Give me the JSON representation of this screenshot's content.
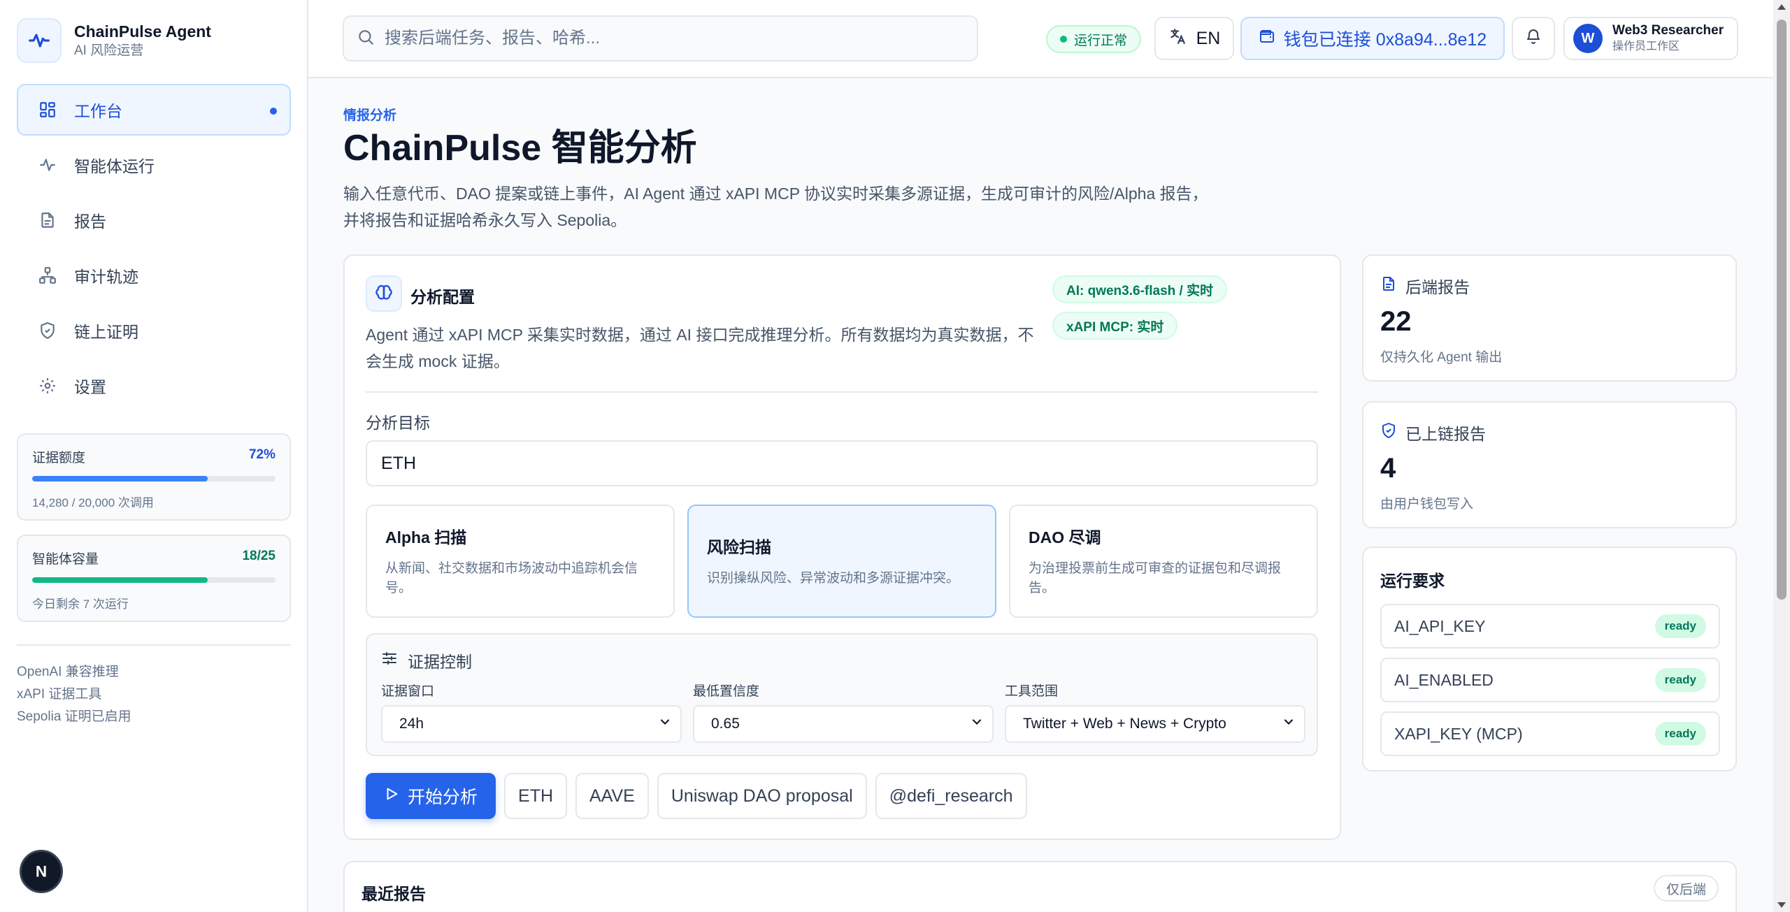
{
  "brand": {
    "title": "ChainPulse Agent",
    "subtitle": "AI 风险运营",
    "icon": "pulse-icon"
  },
  "nav": [
    {
      "label": "工作台",
      "icon": "dashboard-icon",
      "active": true
    },
    {
      "label": "智能体运行",
      "icon": "activity-icon"
    },
    {
      "label": "报告",
      "icon": "file-icon"
    },
    {
      "label": "审计轨迹",
      "icon": "network-icon"
    },
    {
      "label": "链上证明",
      "icon": "shield-icon"
    },
    {
      "label": "设置",
      "icon": "gear-icon"
    }
  ],
  "quota": {
    "label": "证据额度",
    "value": "72%",
    "percent": 72,
    "foot": "14,280 / 20,000 次调用",
    "color": "#3b82f6"
  },
  "capacity": {
    "label": "智能体容量",
    "value": "18/25",
    "percent": 72,
    "foot": "今日剩余 7 次运行",
    "color": "#10b981"
  },
  "side_links": [
    "OpenAI 兼容推理",
    "xAPI 证据工具",
    "Sepolia 证明已启用"
  ],
  "fab_label": "N",
  "header": {
    "search_placeholder": "搜索后端任务、报告、哈希...",
    "status": "运行正常",
    "lang": "EN",
    "wallet": "钱包已连接 0x8a94...8e12",
    "user_initial": "W",
    "user_name": "Web3 Researcher",
    "user_role": "操作员工作区"
  },
  "page": {
    "eyebrow": "情报分析",
    "title": "ChainPulse 智能分析",
    "desc_line1": "输入任意代币、DAO 提案或链上事件，AI Agent 通过 xAPI MCP 协议实时采集多源证据，生成可审计的风险/Alpha 报告，",
    "desc_line2": "并将报告和证据哈希永久写入 Sepolia。"
  },
  "config": {
    "title": "分析配置",
    "desc": "Agent 通过 xAPI MCP 采集实时数据，通过 AI 接口完成推理分析。所有数据均为真实数据，不会生成 mock 证据。",
    "tag_ai": "AI: qwen3.6-flash / 实时",
    "tag_xapi": "xAPI MCP: 实时",
    "target_label": "分析目标",
    "target_value": "ETH",
    "modes": [
      {
        "title": "Alpha 扫描",
        "desc": "从新闻、社交数据和市场波动中追踪机会信号。"
      },
      {
        "title": "风险扫描",
        "desc": "识别操纵风险、异常波动和多源证据冲突。",
        "selected": true
      },
      {
        "title": "DAO 尽调",
        "desc": "为治理投票前生成可审查的证据包和尽调报告。"
      }
    ],
    "evidence": {
      "title": "证据控制",
      "window_label": "证据窗口",
      "window_value": "24h",
      "confidence_label": "最低置信度",
      "confidence_value": "0.65",
      "scope_label": "工具范围",
      "scope_value": "Twitter + Web + News + Crypto"
    },
    "start_label": "开始分析",
    "chips": [
      "ETH",
      "AAVE",
      "Uniswap DAO proposal",
      "@defi_research"
    ]
  },
  "stats": [
    {
      "label": "后端报告",
      "value": "22",
      "sub": "仅持久化 Agent 输出",
      "icon": "file-icon"
    },
    {
      "label": "已上链报告",
      "value": "4",
      "sub": "由用户钱包写入",
      "icon": "shield-check-icon"
    }
  ],
  "requirements": {
    "title": "运行要求",
    "items": [
      {
        "name": "AI_API_KEY",
        "status": "ready"
      },
      {
        "name": "AI_ENABLED",
        "status": "ready"
      },
      {
        "name": "XAPI_KEY (MCP)",
        "status": "ready"
      }
    ]
  },
  "recent": {
    "title": "最近报告",
    "tag": "仅后端"
  }
}
